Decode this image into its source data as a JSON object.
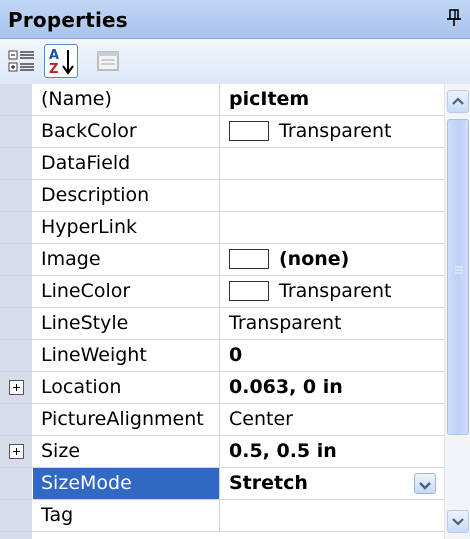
{
  "panel": {
    "title": "Properties"
  },
  "toolbar": {
    "buttons": [
      {
        "name": "categorized-icon"
      },
      {
        "name": "alphabetical-icon",
        "label": "AZ",
        "active": true
      },
      {
        "name": "property-pages-icon"
      }
    ]
  },
  "properties": [
    {
      "name": "(Name)",
      "value": "picItem",
      "bold": true
    },
    {
      "name": "BackColor",
      "value": "Transparent",
      "swatch": true
    },
    {
      "name": "DataField",
      "value": ""
    },
    {
      "name": "Description",
      "value": ""
    },
    {
      "name": "HyperLink",
      "value": ""
    },
    {
      "name": "Image",
      "value": "(none)",
      "bold": true,
      "swatch": true
    },
    {
      "name": "LineColor",
      "value": "Transparent",
      "swatch": true
    },
    {
      "name": "LineStyle",
      "value": "Transparent"
    },
    {
      "name": "LineWeight",
      "value": "0",
      "bold": true
    },
    {
      "name": "Location",
      "value": "0.063, 0 in",
      "bold": true,
      "expandable": true
    },
    {
      "name": "PictureAlignment",
      "value": "Center"
    },
    {
      "name": "Size",
      "value": "0.5, 0.5 in",
      "bold": true,
      "expandable": true
    },
    {
      "name": "SizeMode",
      "value": "Stretch",
      "bold": true,
      "selected": true,
      "dropdown": true
    },
    {
      "name": "Tag",
      "value": ""
    }
  ],
  "colors": {
    "selection": "#3168c4",
    "titlebar": "#a8c3ec",
    "gutter": "#d7dcec"
  }
}
